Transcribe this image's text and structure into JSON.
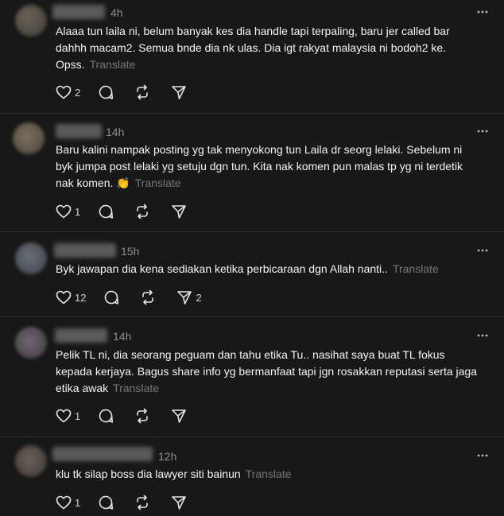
{
  "posts": [
    {
      "time": "4h",
      "text": "Alaaa tun laila ni, belum banyak kes dia handle tapi terpaling, baru jer called bar dahhh macam2. Semua bnde dia nk ulas. Dia igt rakyat malaysia ni bodoh2 ke. Opss.",
      "translate": "Translate",
      "like_count": "2",
      "reply_count": "",
      "repost_count": "",
      "share_count": ""
    },
    {
      "time": "14h",
      "text": "Baru kalini nampak posting yg tak menyokong tun Laila dr seorg lelaki. Sebelum ni byk jumpa post lelaki yg setuju dgn tun. Kita nak komen pun malas tp yg ni terdetik nak komen. 👏",
      "translate": "Translate",
      "like_count": "1",
      "reply_count": "",
      "repost_count": "",
      "share_count": ""
    },
    {
      "time": "15h",
      "text": "Byk jawapan dia kena sediakan ketika perbicaraan dgn Allah nanti..",
      "translate": "Translate",
      "like_count": "12",
      "reply_count": "",
      "repost_count": "",
      "share_count": "2"
    },
    {
      "time": "14h",
      "text": "Pelik TL ni, dia seorang peguam dan tahu etika Tu.. nasihat saya buat TL fokus kepada kerjaya. Bagus share info yg bermanfaat tapi jgn rosakkan reputasi serta jaga etika awak",
      "translate": "Translate",
      "like_count": "1",
      "reply_count": "",
      "repost_count": "",
      "share_count": ""
    },
    {
      "time": "12h",
      "text": "klu tk silap boss dia lawyer siti bainun",
      "translate": "Translate",
      "like_count": "1",
      "reply_count": "",
      "repost_count": "",
      "share_count": ""
    }
  ],
  "colors": {
    "background": "#181818",
    "text": "#f3f5f7",
    "muted": "#8e8e8e",
    "divider": "#2d2d2d"
  },
  "icons": [
    "heart-icon",
    "comment-icon",
    "repost-icon",
    "share-icon",
    "more-icon"
  ]
}
